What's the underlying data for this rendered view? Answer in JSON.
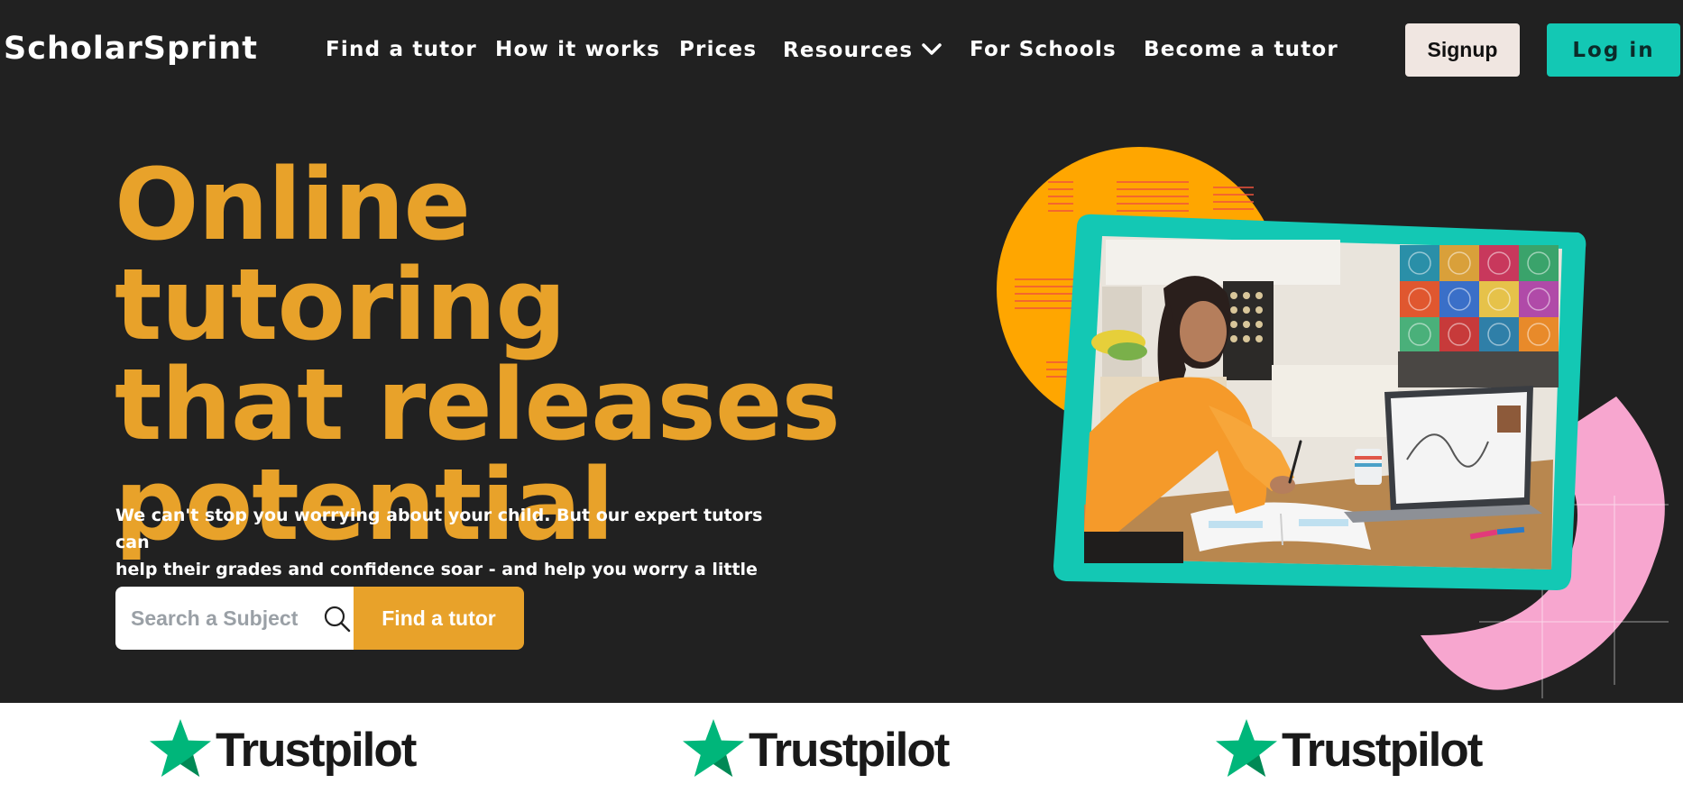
{
  "brand": {
    "name": "ScholarSprint"
  },
  "nav": {
    "links": [
      {
        "label": "Find a tutor"
      },
      {
        "label": "How it works"
      },
      {
        "label": "Prices"
      },
      {
        "label": "Resources"
      },
      {
        "label": "For Schools"
      },
      {
        "label": "Become a tutor"
      }
    ],
    "signup_label": "Signup",
    "login_label": "Log in"
  },
  "hero": {
    "title_lines": [
      "Online tutoring",
      "that releases",
      "potential"
    ],
    "subtitle_lines": [
      "We can't stop you worrying about your child. But our expert tutors can",
      "help their grades and confidence soar - and help you worry a little less."
    ],
    "search": {
      "placeholder": "Search a Subject",
      "value": "",
      "button_label": "Find a tutor"
    }
  },
  "trust": {
    "items": [
      {
        "label": "Trustpilot"
      },
      {
        "label": "Trustpilot"
      },
      {
        "label": "Trustpilot"
      }
    ]
  },
  "colors": {
    "background": "#212121",
    "accent_orange": "#e8a22a",
    "accent_teal": "#13c8b4",
    "pink": "#f7a6cf",
    "trustpilot_green": "#00b67a"
  },
  "icons": {
    "search": "search-icon",
    "dropdown": "chevron-down-icon",
    "star": "star-icon"
  }
}
